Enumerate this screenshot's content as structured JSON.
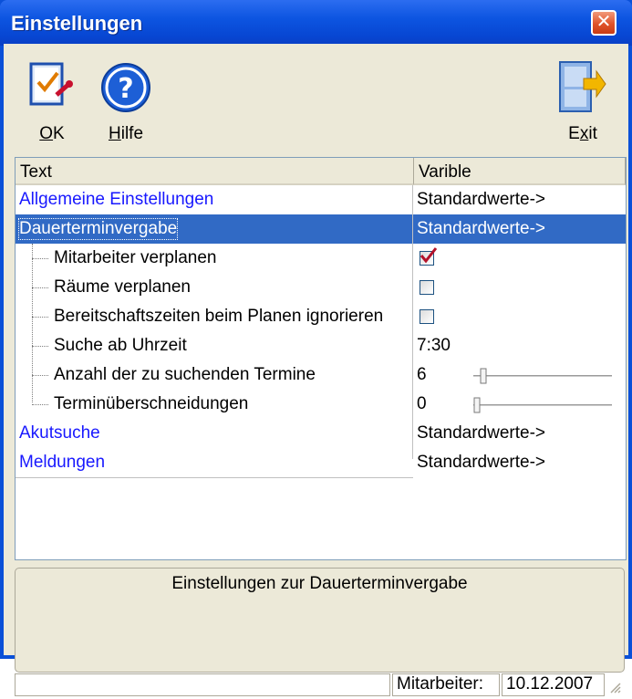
{
  "window": {
    "title": "Einstellungen"
  },
  "toolbar": {
    "ok_label": "K",
    "ok_mnemonic": "O",
    "help_label": "ilfe",
    "help_mnemonic": "H",
    "exit_pre": "E",
    "exit_mnemonic": "x",
    "exit_post": "it"
  },
  "grid": {
    "headers": [
      "Text",
      "Varible"
    ],
    "rows": [
      {
        "text": "Allgemeine Einstellungen",
        "value": "Standardwerte->"
      },
      {
        "text": "Dauerterminvergabe",
        "value": "Standardwerte->"
      },
      {
        "text": "Mitarbeiter verplanen",
        "checked": true
      },
      {
        "text": "Räume verplanen",
        "checked": false
      },
      {
        "text": "Bereitschaftszeiten beim Planen ignorieren",
        "checked": false
      },
      {
        "text": "Suche ab Uhrzeit",
        "value": "7:30"
      },
      {
        "text": "Anzahl der zu suchenden Termine",
        "value": "6"
      },
      {
        "text": "Terminüberschneidungen",
        "value": "0"
      },
      {
        "text": "Akutsuche",
        "value": "Standardwerte->"
      },
      {
        "text": "Meldungen",
        "value": "Standardwerte->"
      }
    ]
  },
  "description": "Einstellungen zur Dauerterminvergabe",
  "statusbar": {
    "label": "Mitarbeiter:",
    "date": "10.12.2007"
  },
  "colors": {
    "selection": "#316ac5",
    "link": "#1818ff",
    "titlebar": "#0a50d8"
  }
}
